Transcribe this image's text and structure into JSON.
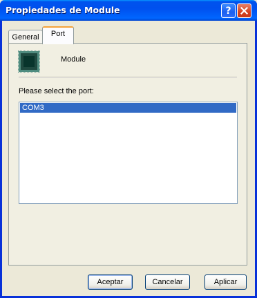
{
  "window": {
    "title": "Propiedades de Module",
    "help_label": "?",
    "close_icon": "close-icon"
  },
  "tabs": [
    {
      "label": "General",
      "selected": false
    },
    {
      "label": "Port",
      "selected": true
    }
  ],
  "device": {
    "icon": "chip-icon",
    "name": "Module"
  },
  "port_section": {
    "label": "Please select the port:",
    "ports": [
      {
        "label": "COM3",
        "selected": true
      }
    ]
  },
  "buttons": {
    "ok": "Aceptar",
    "cancel": "Cancelar",
    "apply": "Aplicar"
  },
  "colors": {
    "titlebar": "#0053ee",
    "selection": "#316ac5",
    "dialog_bg": "#ece9d8",
    "active_tab_accent": "#f5a33a"
  }
}
